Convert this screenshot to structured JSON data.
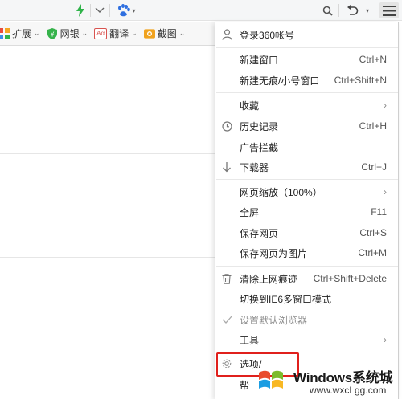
{
  "topbar": {
    "icons": [
      "lightning-icon",
      "dropdown-icon",
      "baidu-paw-icon",
      "search-icon",
      "undo-icon",
      "menu-icon"
    ]
  },
  "toolbar": {
    "items": [
      {
        "label": "扩展",
        "icon": "extensions-icon"
      },
      {
        "label": "网银",
        "icon": "bank-shield-icon"
      },
      {
        "label": "翻译",
        "icon": "translate-icon",
        "icon_text": "Aα"
      },
      {
        "label": "截图",
        "icon": "screenshot-icon"
      }
    ]
  },
  "menu": {
    "account": {
      "label": "登录360帐号"
    },
    "items": [
      {
        "label": "新建窗口",
        "shortcut": "Ctrl+N"
      },
      {
        "label": "新建无痕/小号窗口",
        "shortcut": "Ctrl+Shift+N"
      },
      {
        "label": "收藏",
        "arrow": "›"
      },
      {
        "label": "历史记录",
        "shortcut": "Ctrl+H"
      },
      {
        "label": "广告拦截"
      },
      {
        "label": "下载器",
        "shortcut": "Ctrl+J"
      },
      {
        "label": "网页缩放（100%）",
        "arrow": "›"
      },
      {
        "label": "全屏",
        "shortcut": "F11"
      },
      {
        "label": "保存网页",
        "shortcut": "Ctrl+S"
      },
      {
        "label": "保存网页为图片",
        "shortcut": "Ctrl+M"
      },
      {
        "label": "清除上网痕迹",
        "shortcut": "Ctrl+Shift+Delete"
      },
      {
        "label": "切换到IE6多窗口模式"
      },
      {
        "label": "设置默认浏览器"
      },
      {
        "label": "工具",
        "arrow": "›"
      },
      {
        "label": "选项/"
      },
      {
        "label": "帮"
      }
    ]
  },
  "watermark": {
    "title": "Windows系统城",
    "url": "www.wxcLgg.com"
  },
  "colors": {
    "highlight_border": "#e0201c",
    "lightning": "#2fb34a",
    "baidu_blue": "#2e6fe0"
  }
}
